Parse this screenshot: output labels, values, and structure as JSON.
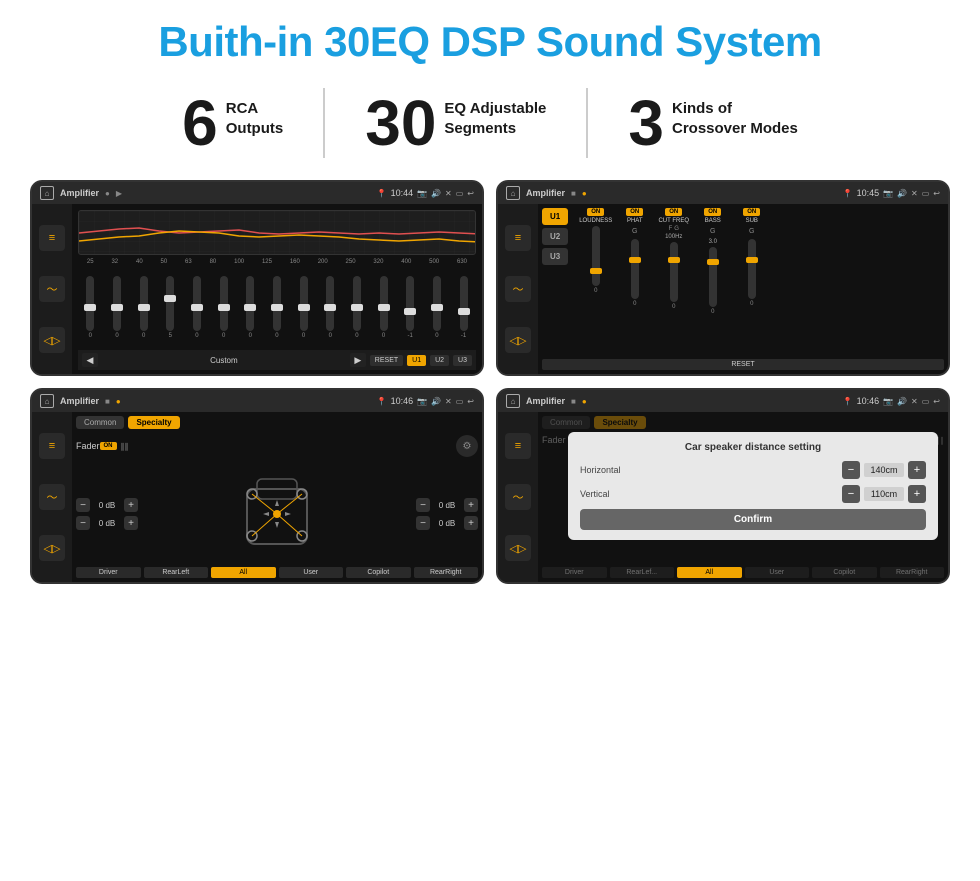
{
  "page": {
    "title": "Buith-in 30EQ DSP Sound System",
    "background": "#ffffff"
  },
  "stats": [
    {
      "number": "6",
      "label_line1": "RCA",
      "label_line2": "Outputs"
    },
    {
      "number": "30",
      "label_line1": "EQ Adjustable",
      "label_line2": "Segments"
    },
    {
      "number": "3",
      "label_line1": "Kinds of",
      "label_line2": "Crossover Modes"
    }
  ],
  "screens": [
    {
      "id": "eq-screen",
      "status_bar": {
        "title": "Amplifier",
        "time": "10:44",
        "icons": [
          "home",
          "menu",
          "play",
          "location",
          "camera",
          "volume",
          "x",
          "window",
          "back"
        ]
      },
      "type": "eq",
      "freq_labels": [
        "25",
        "32",
        "40",
        "50",
        "63",
        "80",
        "100",
        "125",
        "160",
        "200",
        "250",
        "320",
        "400",
        "500",
        "630"
      ],
      "slider_values": [
        "0",
        "0",
        "0",
        "5",
        "0",
        "0",
        "0",
        "0",
        "0",
        "0",
        "0",
        "0",
        "-1",
        "0",
        "-1"
      ],
      "preset_label": "Custom",
      "bottom_buttons": [
        "RESET",
        "U1",
        "U2",
        "U3"
      ]
    },
    {
      "id": "crossover-screen",
      "status_bar": {
        "title": "Amplifier",
        "time": "10:45"
      },
      "type": "crossover",
      "u_buttons": [
        "U1",
        "U2",
        "U3"
      ],
      "active_u": "U1",
      "modules": [
        {
          "label": "LOUDNESS",
          "on": true,
          "type": "toggle"
        },
        {
          "label": "PHAT",
          "on": true,
          "type": "slider"
        },
        {
          "label": "CUT FREQ",
          "on": true,
          "type": "slider"
        },
        {
          "label": "BASS",
          "on": true,
          "type": "slider"
        },
        {
          "label": "SUB",
          "on": true,
          "type": "slider"
        }
      ],
      "reset_label": "RESET"
    },
    {
      "id": "fader-screen",
      "status_bar": {
        "title": "Amplifier",
        "time": "10:46"
      },
      "type": "fader",
      "tabs": [
        "Common",
        "Specialty"
      ],
      "active_tab": "Specialty",
      "fader_label": "Fader",
      "fader_on": true,
      "vol_rows": [
        {
          "value": "0 dB"
        },
        {
          "value": "0 dB"
        },
        {
          "value": "0 dB"
        },
        {
          "value": "0 dB"
        }
      ],
      "bottom_buttons": [
        {
          "label": "Driver",
          "active": false
        },
        {
          "label": "All",
          "active": true
        },
        {
          "label": "User",
          "active": false
        },
        {
          "label": "RearLeft",
          "active": false
        },
        {
          "label": "Copilot",
          "active": false
        },
        {
          "label": "RearRight",
          "active": false
        }
      ]
    },
    {
      "id": "distance-screen",
      "status_bar": {
        "title": "Amplifier",
        "time": "10:46"
      },
      "type": "distance",
      "tabs": [
        "Common",
        "Specialty"
      ],
      "active_tab": "Specialty",
      "dialog": {
        "title": "Car speaker distance setting",
        "horizontal_label": "Horizontal",
        "horizontal_value": "140cm",
        "vertical_label": "Vertical",
        "vertical_value": "110cm",
        "confirm_label": "Confirm"
      },
      "bottom_buttons": [
        {
          "label": "Driver",
          "active": false
        },
        {
          "label": "All",
          "active": true
        },
        {
          "label": "User",
          "active": false
        },
        {
          "label": "RearLeft",
          "active": false
        },
        {
          "label": "Copilot",
          "active": false
        },
        {
          "label": "RearRight",
          "active": false
        }
      ]
    }
  ]
}
